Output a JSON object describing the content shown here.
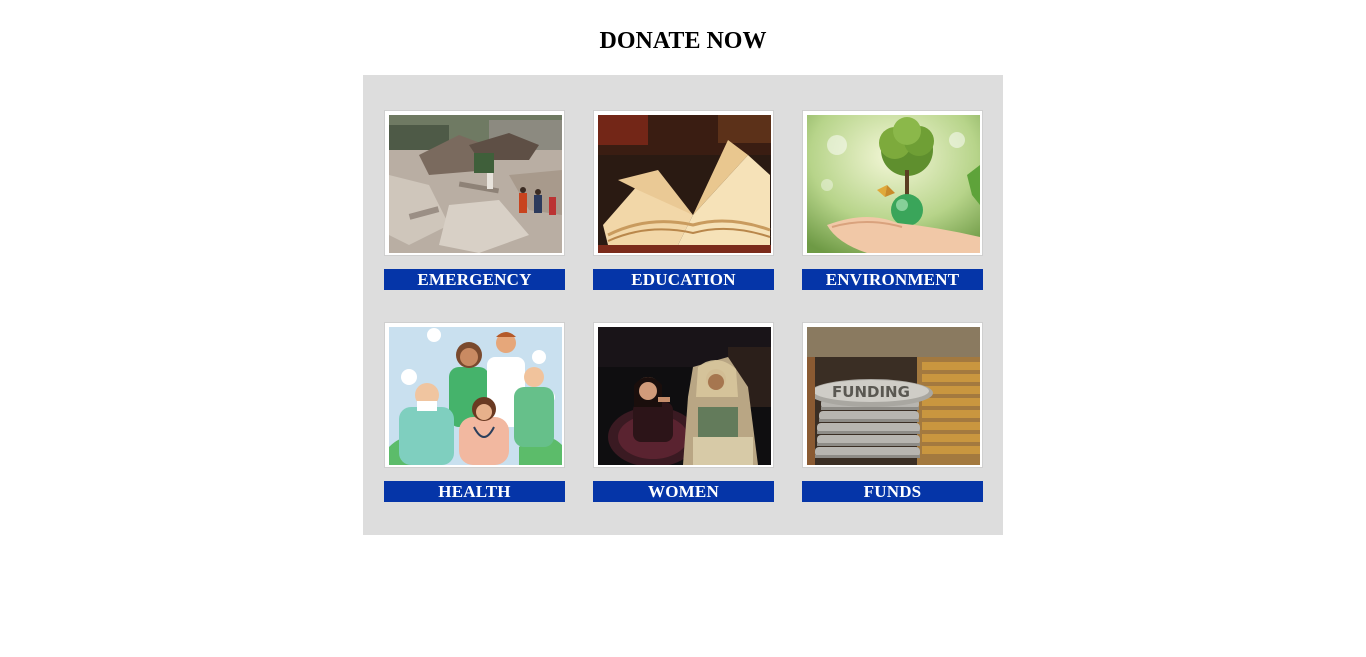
{
  "page": {
    "title": "DONATE NOW"
  },
  "theme": {
    "panel_bg": "#dddddd",
    "label_bg": "#0535a8",
    "label_fg": "#ffffff"
  },
  "causes": [
    {
      "label": "EMERGENCY",
      "image": "earthquake-rubble-photo"
    },
    {
      "label": "EDUCATION",
      "image": "open-book-photo"
    },
    {
      "label": "ENVIRONMENT",
      "image": "hand-holding-tree-globe-photo"
    },
    {
      "label": "HEALTH",
      "image": "healthcare-workers-illustration"
    },
    {
      "label": "WOMEN",
      "image": "two-women-seated-photo"
    },
    {
      "label": "FUNDS",
      "image": "funding-coin-stack-photo"
    }
  ]
}
